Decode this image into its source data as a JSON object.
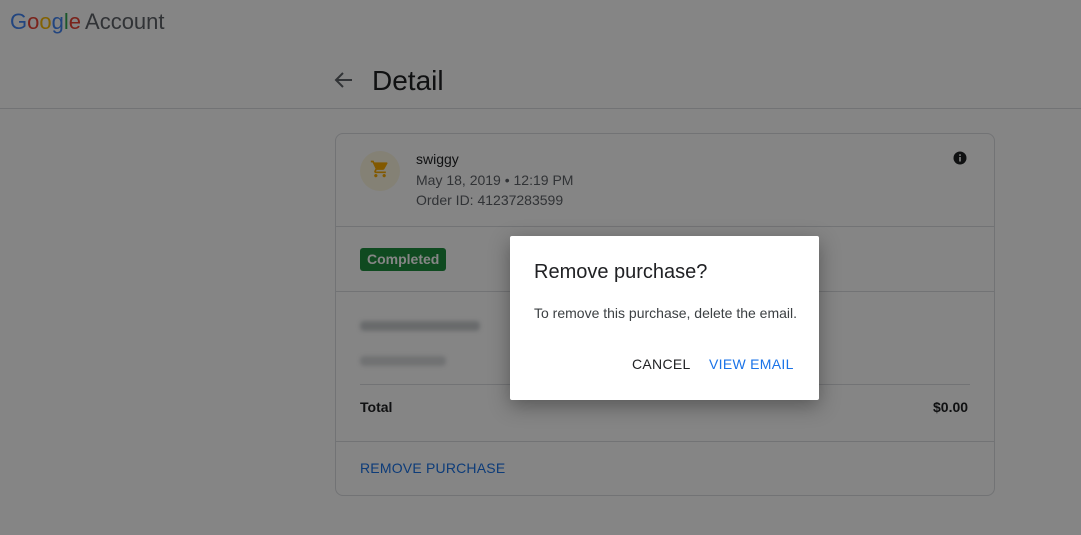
{
  "app": {
    "logo_letters": [
      "G",
      "o",
      "o",
      "g",
      "l",
      "e"
    ],
    "logo_suffix": "Account"
  },
  "colors": {
    "logo": [
      "#4285f4",
      "#ea4335",
      "#fbbc05",
      "#4285f4",
      "#34a853",
      "#ea4335"
    ],
    "status_green": "#1e8e3e",
    "link_blue": "#1a73e8"
  },
  "header": {
    "title": "Detail",
    "back_icon": "arrow-left-icon"
  },
  "purchase": {
    "merchant_icon": "shopping-cart-icon",
    "merchant": "swiggy",
    "datetime": "May 18, 2019 • 12:19 PM",
    "order_id": "Order ID: 41237283599",
    "status": "Completed",
    "total_label": "Total",
    "total_value": "$0.00",
    "remove_label": "REMOVE PURCHASE"
  },
  "dialog": {
    "title": "Remove purchase?",
    "body": "To remove this purchase, delete the email.",
    "cancel_label": "CANCEL",
    "confirm_label": "VIEW EMAIL"
  }
}
